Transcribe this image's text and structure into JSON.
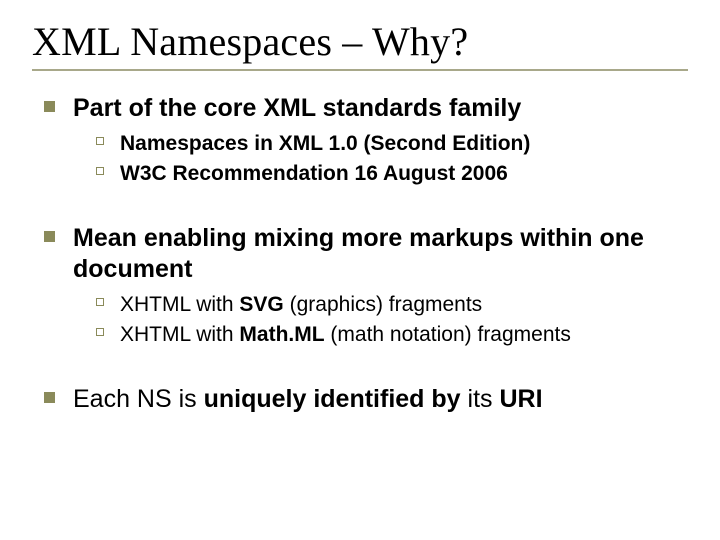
{
  "title": "XML Namespaces – Why?",
  "items": [
    {
      "text": "Part of the core XML standards family",
      "bold": true,
      "sub": [
        {
          "text": "Namespaces in XML 1.0 (Second Edition)",
          "bold": true
        },
        {
          "text": "W3C Recommendation 16 August 2006",
          "bold": true
        }
      ]
    },
    {
      "text": "Mean enabling mixing more markups within one document",
      "bold": true,
      "sub": [
        {
          "html": "XHTML with <b>SVG</b> (graphics) fragments"
        },
        {
          "html": "XHTML with <b>Math.ML</b> (math notation) fragments"
        }
      ]
    },
    {
      "html": "Each NS is <b>uniquely identified by</b> its <b>URI</b>",
      "sub": []
    }
  ]
}
